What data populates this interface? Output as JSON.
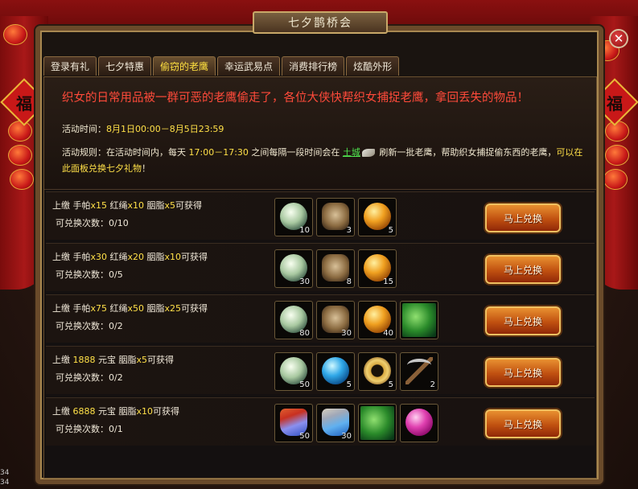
{
  "window": {
    "title": "七夕鹊桥会",
    "close_symbol": "✕",
    "fu": "福"
  },
  "tabs": [
    {
      "label": "登录有礼"
    },
    {
      "label": "七夕特惠"
    },
    {
      "label": "偷窃的老鹰",
      "active": true
    },
    {
      "label": "幸运武易点"
    },
    {
      "label": "消费排行榜"
    },
    {
      "label": "炫酷外形"
    }
  ],
  "intro": {
    "headline": "织女的日常用品被一群可恶的老鹰偷走了，各位大侠快帮织女捕捉老鹰，拿回丢失的物品！",
    "time_label": "活动时间：",
    "time_value": "8月1日00:00－8月5日23:59",
    "rule_label": "活动规则：在活动时间内，每天 ",
    "rule_time": "17:00－17:30",
    "rule_mid": " 之间每隔一段时间会在 ",
    "rule_place": "土城",
    "rule_after": " 刷新一批老鹰，帮助织女捕捉偷东西的老鹰，",
    "rule_highlight": "可以在此面板兑换七夕礼物",
    "rule_end": "！"
  },
  "rows": [
    {
      "desc": [
        {
          "t": "上缴 手帕"
        },
        {
          "t": "x15",
          "y": true
        },
        {
          "t": " 红绳"
        },
        {
          "t": "x10",
          "y": true
        },
        {
          "t": " 胭脂"
        },
        {
          "t": "x5",
          "y": true
        },
        {
          "t": "可获得"
        }
      ],
      "count": "可兑换次数：0/10",
      "items": [
        {
          "icon": "pearl-icon",
          "cls": "pearl",
          "qty": "10"
        },
        {
          "icon": "rope-icon",
          "cls": "rope",
          "qty": "3"
        },
        {
          "icon": "rouge-orb-icon",
          "cls": "rouge",
          "qty": "5"
        }
      ],
      "button": "马上兑换"
    },
    {
      "desc": [
        {
          "t": "上缴 手帕"
        },
        {
          "t": "x30",
          "y": true
        },
        {
          "t": " 红绳"
        },
        {
          "t": "x20",
          "y": true
        },
        {
          "t": " 胭脂"
        },
        {
          "t": "x10",
          "y": true
        },
        {
          "t": "可获得"
        }
      ],
      "count": "可兑换次数：0/5",
      "items": [
        {
          "icon": "pearl-icon",
          "cls": "pearl",
          "qty": "30"
        },
        {
          "icon": "rope-icon",
          "cls": "rope",
          "qty": "8"
        },
        {
          "icon": "rouge-orb-icon",
          "cls": "rouge",
          "qty": "15"
        }
      ],
      "button": "马上兑换"
    },
    {
      "desc": [
        {
          "t": "上缴 手帕"
        },
        {
          "t": "x75",
          "y": true
        },
        {
          "t": " 红绳"
        },
        {
          "t": "x50",
          "y": true
        },
        {
          "t": " 胭脂"
        },
        {
          "t": "x25",
          "y": true
        },
        {
          "t": "可获得"
        }
      ],
      "count": "可兑换次数：0/2",
      "items": [
        {
          "icon": "pearl-icon",
          "cls": "pearl",
          "qty": "80"
        },
        {
          "icon": "rope-icon",
          "cls": "rope",
          "qty": "30"
        },
        {
          "icon": "rouge-orb-icon",
          "cls": "rouge",
          "qty": "40"
        },
        {
          "icon": "leaf-icon",
          "cls": "leaf",
          "qty": ""
        }
      ],
      "button": "马上兑换"
    },
    {
      "desc": [
        {
          "t": "上缴 "
        },
        {
          "t": "1888",
          "y": true
        },
        {
          "t": " 元宝 胭脂"
        },
        {
          "t": "x5",
          "y": true
        },
        {
          "t": "可获得"
        }
      ],
      "count": "可兑换次数：0/2",
      "items": [
        {
          "icon": "pearl-icon",
          "cls": "pearl",
          "qty": "50"
        },
        {
          "icon": "blue-orb-icon",
          "cls": "blue",
          "qty": "5"
        },
        {
          "icon": "coin-icon",
          "cls": "coin",
          "qty": "5"
        },
        {
          "icon": "pickaxe-icon",
          "cls": "pick",
          "qty": "2"
        }
      ],
      "button": "马上兑换"
    },
    {
      "desc": [
        {
          "t": "上缴 "
        },
        {
          "t": "6888",
          "y": true
        },
        {
          "t": " 元宝 胭脂"
        },
        {
          "t": "x10",
          "y": true
        },
        {
          "t": "可获得"
        }
      ],
      "count": "可兑换次数：0/1",
      "items": [
        {
          "icon": "red-potion-icon",
          "cls": "potion",
          "qty": "50"
        },
        {
          "icon": "blue-flask-icon",
          "cls": "flask",
          "qty": "30"
        },
        {
          "icon": "leaf-icon",
          "cls": "leaf",
          "qty": ""
        },
        {
          "icon": "pink-orb-icon",
          "cls": "pink",
          "qty": ""
        }
      ],
      "button": "马上兑换"
    }
  ],
  "corner": {
    "a": "34",
    "b": "34"
  }
}
